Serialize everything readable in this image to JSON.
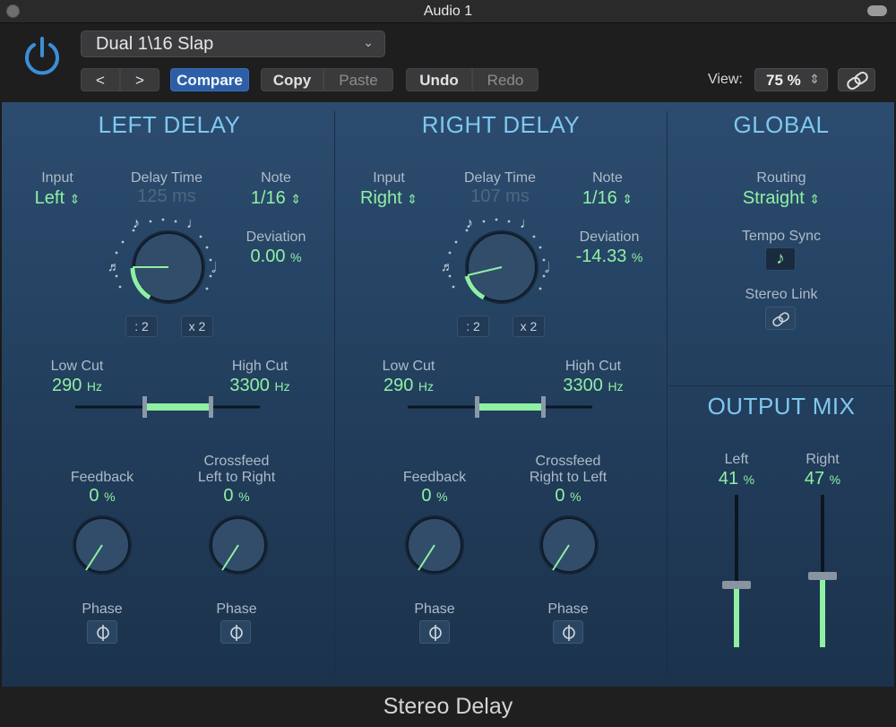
{
  "window": {
    "title": "Audio 1"
  },
  "header": {
    "preset": "Dual 1\\16 Slap",
    "prev_label": "<",
    "next_label": ">",
    "compare_label": "Compare",
    "copy_label": "Copy",
    "paste_label": "Paste",
    "undo_label": "Undo",
    "redo_label": "Redo",
    "view_label": "View:",
    "view_value": "75 %"
  },
  "left_delay": {
    "title": "LEFT DELAY",
    "input_label": "Input",
    "input_value": "Left",
    "delay_time_label": "Delay Time",
    "delay_time_value": "125 ms",
    "note_label": "Note",
    "note_value": "1/16",
    "deviation_label": "Deviation",
    "deviation_value": "0.00",
    "deviation_unit": "%",
    "divide_label": ": 2",
    "multiply_label": "x 2",
    "low_cut_label": "Low Cut",
    "low_cut_value": "290",
    "low_cut_unit": "Hz",
    "high_cut_label": "High Cut",
    "high_cut_value": "3300",
    "high_cut_unit": "Hz",
    "feedback_label": "Feedback",
    "feedback_value": "0",
    "feedback_unit": "%",
    "crossfeed_label_1": "Crossfeed",
    "crossfeed_label_2": "Left to Right",
    "crossfeed_value": "0",
    "crossfeed_unit": "%",
    "phase_label_1": "Phase",
    "phase_label_2": "Phase"
  },
  "right_delay": {
    "title": "RIGHT DELAY",
    "input_label": "Input",
    "input_value": "Right",
    "delay_time_label": "Delay Time",
    "delay_time_value": "107 ms",
    "note_label": "Note",
    "note_value": "1/16",
    "deviation_label": "Deviation",
    "deviation_value": "-14.33",
    "deviation_unit": "%",
    "divide_label": ": 2",
    "multiply_label": "x 2",
    "low_cut_label": "Low Cut",
    "low_cut_value": "290",
    "low_cut_unit": "Hz",
    "high_cut_label": "High Cut",
    "high_cut_value": "3300",
    "high_cut_unit": "Hz",
    "feedback_label": "Feedback",
    "feedback_value": "0",
    "feedback_unit": "%",
    "crossfeed_label_1": "Crossfeed",
    "crossfeed_label_2": "Right to Left",
    "crossfeed_value": "0",
    "crossfeed_unit": "%",
    "phase_label_1": "Phase",
    "phase_label_2": "Phase"
  },
  "global": {
    "title": "GLOBAL",
    "routing_label": "Routing",
    "routing_value": "Straight",
    "tempo_sync_label": "Tempo Sync",
    "tempo_sync_icon": "♪",
    "stereo_link_label": "Stereo Link"
  },
  "output_mix": {
    "title": "OUTPUT MIX",
    "left_label": "Left",
    "left_value": "41",
    "left_unit": "%",
    "right_label": "Right",
    "right_value": "47",
    "right_unit": "%"
  },
  "footer": {
    "title": "Stereo Delay"
  },
  "colors": {
    "accent_green": "#8ff0a4",
    "section_title": "#7fc7f0",
    "compare_blue": "#2d5fa8",
    "power_blue": "#3b8fd9"
  },
  "icons": {
    "power": "power-icon",
    "link": "link-icon",
    "phase": "phase-icon",
    "note": "note-icon",
    "dropdown": "chevron-down-icon"
  }
}
